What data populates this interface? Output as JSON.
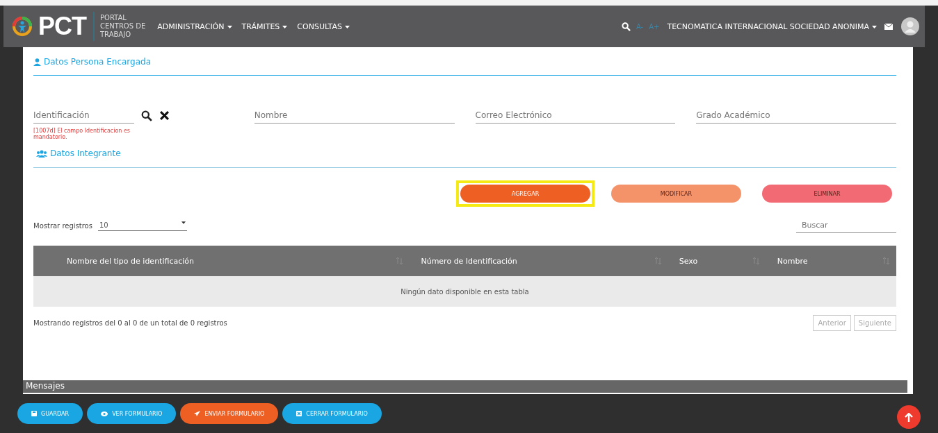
{
  "header": {
    "logo": "PCT",
    "portal_title": [
      "PORTAL",
      "CENTROS DE",
      "TRABAJO"
    ],
    "menu": [
      {
        "label": "ADMINISTRACIÓN"
      },
      {
        "label": "TRÁMITES"
      },
      {
        "label": "CONSULTAS"
      }
    ],
    "font_small": "A-",
    "font_large": "A+",
    "company": "TECNOMATICA INTERNACIONAL SOCIEDAD ANONIMA"
  },
  "section_person": {
    "title": "Datos Persona Encargada",
    "fields": [
      {
        "placeholder": "Identificación",
        "kind": "lookup",
        "error": "[1007d] El campo Identificacion es mandatorio."
      },
      {
        "placeholder": "Nombre",
        "kind": "text"
      },
      {
        "placeholder": "Correo Electrónico",
        "kind": "text"
      },
      {
        "placeholder": "Grado Académico",
        "kind": "text"
      }
    ]
  },
  "section_member": {
    "title": "Datos Integrante"
  },
  "actions": [
    {
      "label": "AGREGAR",
      "kind": "add",
      "disabled": false,
      "focused": true
    },
    {
      "label": "MODIFICAR",
      "kind": "edit",
      "disabled": true,
      "focused": false
    },
    {
      "label": "ELIMINAR",
      "kind": "delete",
      "disabled": true,
      "focused": false
    }
  ],
  "table_controls": {
    "show_label": "Mostrar registros",
    "page_size": "10",
    "search_placeholder": "Buscar"
  },
  "table": {
    "columns": [
      "Nombre del tipo de identificación",
      "Número de Identificación",
      "Sexo",
      "Nombre"
    ],
    "empty_message": "Ningún dato disponible en esta tabla",
    "info": "Mostrando registros del 0 al 0 de un total de 0 registros",
    "pager": [
      {
        "label": "Anterior",
        "disabled": true
      },
      {
        "label": "Siguiente",
        "disabled": true
      }
    ]
  },
  "messages_bar": "Mensajes",
  "bottom_buttons": [
    {
      "label": "GUARDAR",
      "kind": "save"
    },
    {
      "label": "VER FORMULARIO",
      "kind": "view"
    },
    {
      "label": "ENVIAR FORMULARIO",
      "kind": "send"
    },
    {
      "label": "CERRAR FORMULARIO",
      "kind": "close"
    }
  ]
}
